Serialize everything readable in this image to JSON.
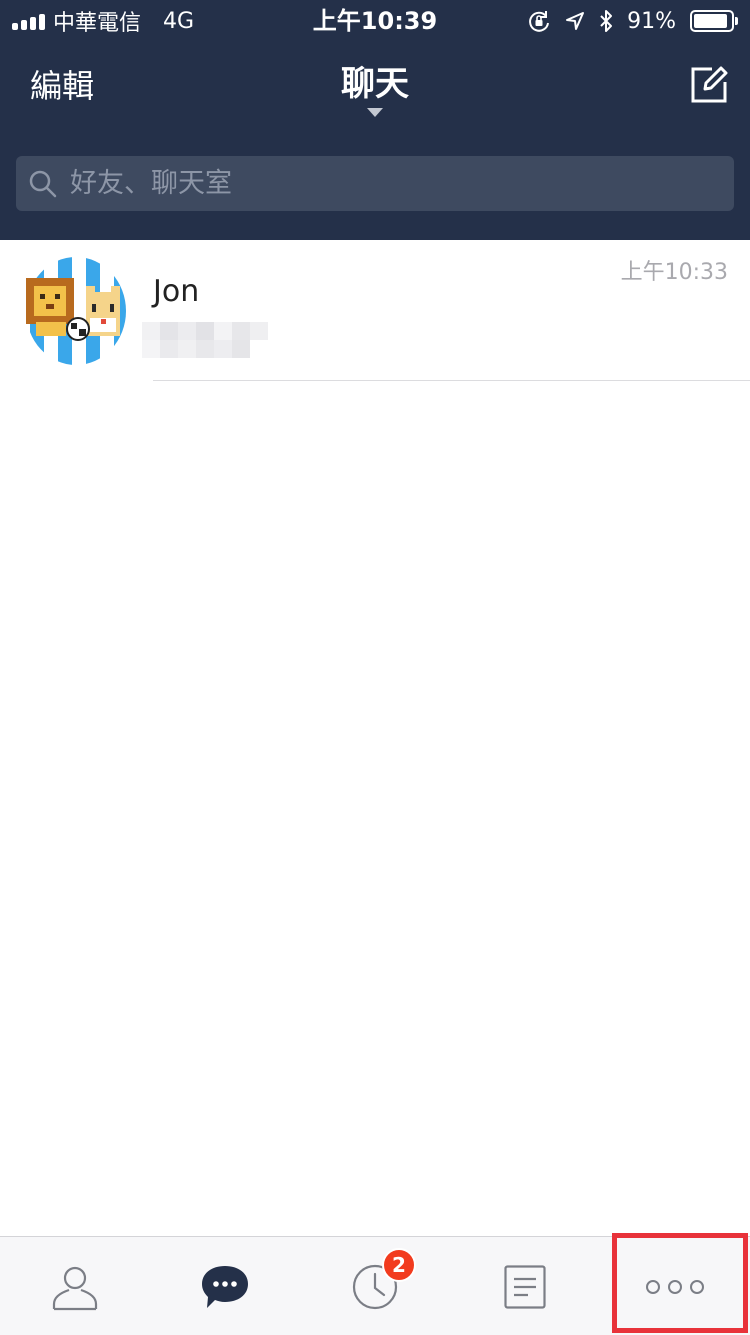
{
  "status_bar": {
    "carrier": "中華電信",
    "network": "4G",
    "time": "上午10:39",
    "battery": "91%",
    "battery_level": 0.91
  },
  "nav": {
    "edit_label": "編輯",
    "title": "聊天",
    "compose_icon": "compose-icon"
  },
  "search": {
    "placeholder": "好友、聊天室"
  },
  "chats": [
    {
      "name": "Jon",
      "time": "上午10:33"
    }
  ],
  "tab_bar": {
    "tabs": [
      "friends-icon",
      "chats-icon",
      "timeline-icon",
      "news-icon",
      "more-icon"
    ],
    "timeline_badge": "2"
  },
  "colors": {
    "header_bg": "#243049",
    "search_bg": "#3e4a60",
    "badge": "#f23b1e",
    "highlight": "#e8323a"
  }
}
